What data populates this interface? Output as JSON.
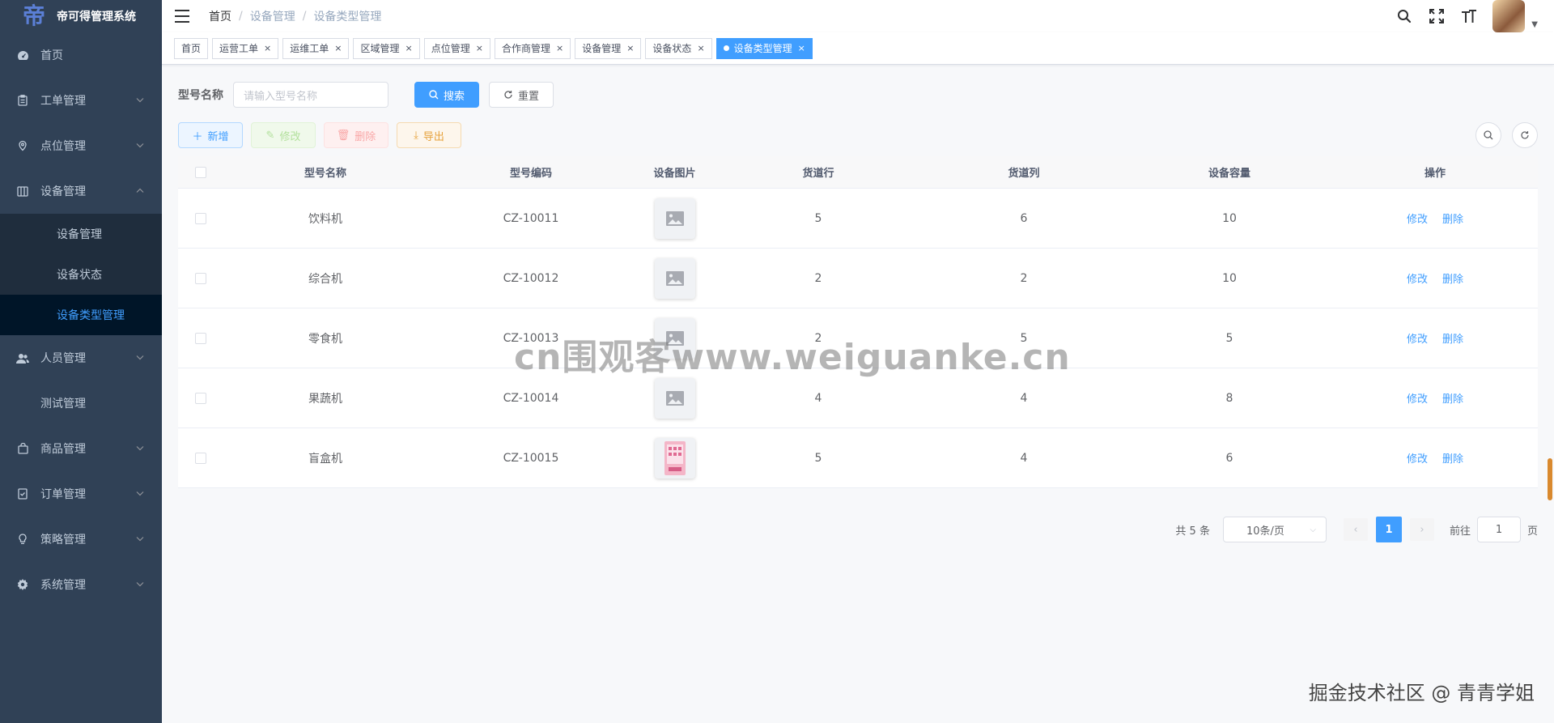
{
  "app": {
    "title": "帝可得管理系统",
    "logo_glyph": "帝"
  },
  "sidebar": {
    "items": [
      {
        "label": "首页",
        "icon": "dashboard-icon"
      },
      {
        "label": "工单管理",
        "icon": "clipboard-icon",
        "arrow": "down"
      },
      {
        "label": "点位管理",
        "icon": "location-pin-icon",
        "arrow": "down"
      },
      {
        "label": "设备管理",
        "icon": "device-icon",
        "arrow": "up"
      }
    ],
    "submenu": [
      {
        "label": "设备管理"
      },
      {
        "label": "设备状态"
      },
      {
        "label": "设备类型管理",
        "active": true
      }
    ],
    "items2": [
      {
        "label": "人员管理",
        "icon": "people-icon",
        "arrow": "down"
      },
      {
        "label": "测试管理",
        "icon": "",
        "arrow": ""
      },
      {
        "label": "商品管理",
        "icon": "shopping-bag-icon",
        "arrow": "down"
      },
      {
        "label": "订单管理",
        "icon": "order-icon",
        "arrow": "down"
      },
      {
        "label": "策略管理",
        "icon": "bulb-icon",
        "arrow": "down"
      },
      {
        "label": "系统管理",
        "icon": "gear-icon",
        "arrow": "down"
      }
    ]
  },
  "breadcrumb": [
    "首页",
    "设备管理",
    "设备类型管理"
  ],
  "tags": [
    "首页",
    "运营工单",
    "运维工单",
    "区域管理",
    "点位管理",
    "合作商管理",
    "设备管理",
    "设备状态",
    "设备类型管理"
  ],
  "search": {
    "label": "型号名称",
    "placeholder": "请输入型号名称",
    "search_btn": "搜索",
    "reset_btn": "重置"
  },
  "toolbar": {
    "add": "新增",
    "edit": "修改",
    "delete": "删除",
    "export": "导出"
  },
  "table": {
    "headers": [
      "型号名称",
      "型号编码",
      "设备图片",
      "货道行",
      "货道列",
      "设备容量",
      "操作"
    ],
    "rows": [
      {
        "name": "饮料机",
        "code": "CZ-10011",
        "image": "placeholder",
        "row": "5",
        "col": "6",
        "cap": "10"
      },
      {
        "name": "综合机",
        "code": "CZ-10012",
        "image": "placeholder",
        "row": "2",
        "col": "2",
        "cap": "10"
      },
      {
        "name": "零食机",
        "code": "CZ-10013",
        "image": "placeholder",
        "row": "2",
        "col": "5",
        "cap": "5"
      },
      {
        "name": "果蔬机",
        "code": "CZ-10014",
        "image": "placeholder",
        "row": "4",
        "col": "4",
        "cap": "8"
      },
      {
        "name": "盲盒机",
        "code": "CZ-10015",
        "image": "vending-photo",
        "row": "5",
        "col": "4",
        "cap": "6"
      }
    ],
    "op_edit": "修改",
    "op_delete": "删除"
  },
  "pagination": {
    "total": "共 5 条",
    "page_size": "10条/页",
    "current": "1",
    "goto_prefix": "前往",
    "goto_value": "1",
    "goto_suffix": "页"
  },
  "overlay": {
    "watermark": "cn围观客www.weiguanke.cn",
    "credit": "掘金技术社区 @ 青青学姐"
  },
  "colors": {
    "sidebar_bg": "#304156",
    "submenu_bg": "#1f2d3d",
    "accent": "#409eff"
  }
}
